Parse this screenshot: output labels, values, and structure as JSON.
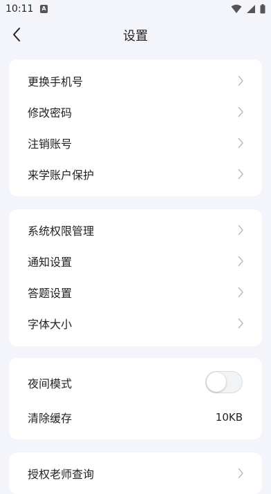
{
  "status_bar": {
    "time": "10:11",
    "app_icon_glyph": "A"
  },
  "nav": {
    "title": "设置"
  },
  "group1": [
    {
      "label": "更换手机号"
    },
    {
      "label": "修改密码"
    },
    {
      "label": "注销账号"
    },
    {
      "label": "来学账户保护"
    }
  ],
  "group2": [
    {
      "label": "系统权限管理"
    },
    {
      "label": "通知设置"
    },
    {
      "label": "答题设置"
    },
    {
      "label": "字体大小"
    }
  ],
  "group3": {
    "night_mode": {
      "label": "夜间模式",
      "enabled": false
    },
    "clear_cache": {
      "label": "清除缓存",
      "value": "10KB"
    }
  },
  "group4": [
    {
      "label": "授权老师查询"
    }
  ],
  "colors": {
    "background": "#f3f5fb",
    "card": "#ffffff",
    "chevron": "#b5b8bf",
    "text": "#222222"
  }
}
